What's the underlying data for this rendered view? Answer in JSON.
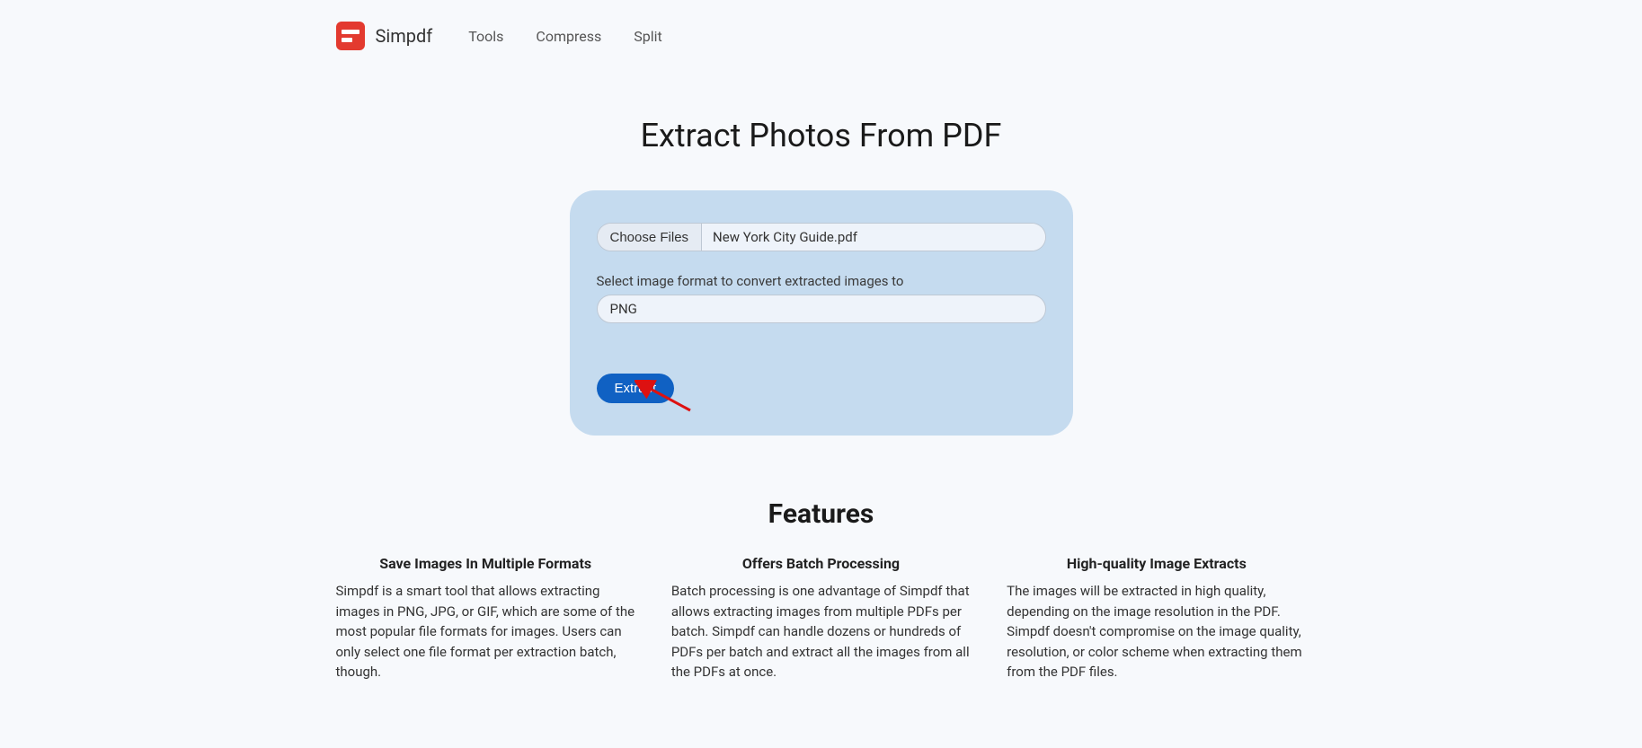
{
  "brand": {
    "name": "Simpdf"
  },
  "nav": {
    "items": [
      {
        "label": "Tools"
      },
      {
        "label": "Compress"
      },
      {
        "label": "Split"
      }
    ]
  },
  "page": {
    "title": "Extract Photos From PDF"
  },
  "upload": {
    "choose_label": "Choose Files",
    "file_name": "New York City Guide.pdf",
    "format_label": "Select image format to convert extracted images to",
    "format_value": "PNG",
    "extract_label": "Extract"
  },
  "features": {
    "heading": "Features",
    "items": [
      {
        "title": "Save Images In Multiple Formats",
        "desc": "Simpdf is a smart tool that allows extracting images in PNG, JPG, or GIF, which are some of the most popular file formats for images. Users can only select one file format per extraction batch, though."
      },
      {
        "title": "Offers Batch Processing",
        "desc": "Batch processing is one advantage of Simpdf that allows extracting images from multiple PDFs per batch. Simpdf can handle dozens or hundreds of PDFs per batch and extract all the images from all the PDFs at once."
      },
      {
        "title": "High-quality Image Extracts",
        "desc": "The images will be extracted in high quality, depending on the image resolution in the PDF. Simpdf doesn't compromise on the image quality, resolution, or color scheme when extracting them from the PDF files."
      }
    ]
  },
  "colors": {
    "brand_red": "#e33a2f",
    "card_bg": "#c5dbef",
    "primary_button": "#1061c3",
    "page_bg": "#f7f9fc"
  }
}
